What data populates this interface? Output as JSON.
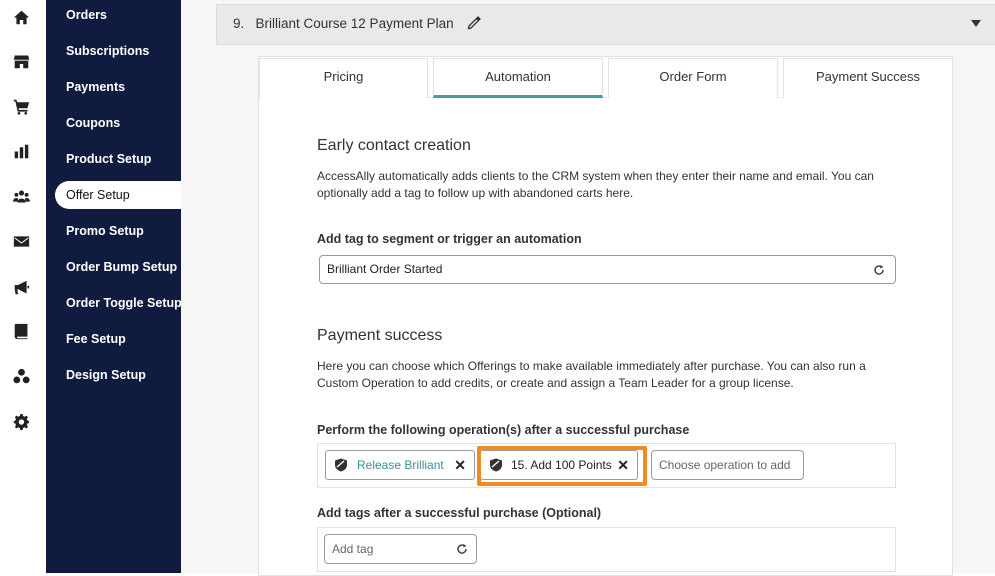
{
  "rail": {
    "icons": [
      "home-icon",
      "store-icon",
      "cart-icon",
      "bar-chart-icon",
      "users-icon",
      "envelope-icon",
      "megaphone-icon",
      "book-icon",
      "groups-icon",
      "gear-icon"
    ]
  },
  "sidebar": {
    "items": [
      {
        "label": "Orders"
      },
      {
        "label": "Subscriptions"
      },
      {
        "label": "Payments"
      },
      {
        "label": "Coupons"
      },
      {
        "label": "Product Setup"
      },
      {
        "label": "Offer Setup"
      },
      {
        "label": "Promo Setup"
      },
      {
        "label": "Order Bump Setup"
      },
      {
        "label": "Order Toggle Setup"
      },
      {
        "label": "Fee Setup"
      },
      {
        "label": "Design Setup"
      }
    ],
    "active": "Offer Setup"
  },
  "offer": {
    "title": "9.   Brilliant Course 12 Payment Plan"
  },
  "tabs": [
    {
      "label": "Pricing"
    },
    {
      "label": "Automation"
    },
    {
      "label": "Order Form"
    },
    {
      "label": "Payment Success"
    }
  ],
  "active_tab": "Automation",
  "early": {
    "heading": "Early contact creation",
    "description": "AccessAlly automatically adds clients to the CRM system when they enter their name and email. You can optionally add a tag to follow up with abandoned carts here.",
    "tag_label": "Add tag to segment or trigger an automation",
    "tag_value": "Brilliant Order Started"
  },
  "payment": {
    "heading": "Payment success",
    "description": "Here you can choose which Offerings to make available immediately after purchase. You can also run a Custom Operation to add credits, or create and assign a Team Leader for a group license.",
    "ops_label": "Perform the following operation(s) after a successful purchase",
    "ops": [
      {
        "label": "Release Brilliant",
        "color": "#3a8ea0"
      },
      {
        "label": "15. Add 100 Points",
        "color": "#222222"
      }
    ],
    "ops_placeholder": "Choose operation to add",
    "tags_label": "Add tags after a successful purchase (Optional)",
    "tags_placeholder": "Add tag"
  },
  "colors": {
    "sidebar_bg": "#0f1c3f",
    "tab_accent": "#4a9aa8",
    "highlight": "#f08a24",
    "link": "#3a8ea0"
  }
}
